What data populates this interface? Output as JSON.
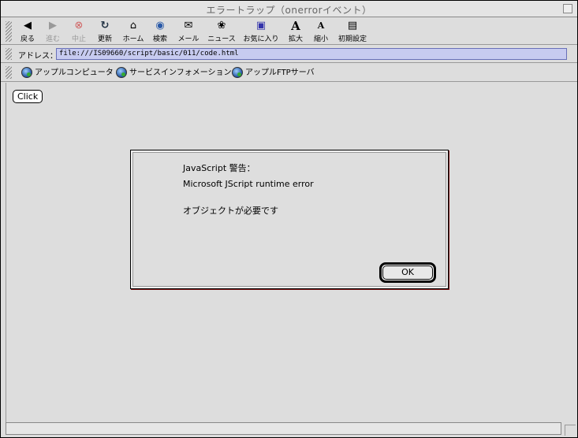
{
  "window": {
    "title": "エラートラップ（onerrorイベント）"
  },
  "toolbar": {
    "buttons": [
      {
        "label": "戻る",
        "icon": "back-arrow-icon",
        "glyph": "◆",
        "enabled": true
      },
      {
        "label": "進む",
        "icon": "forward-arrow-icon",
        "glyph": "➡",
        "enabled": false
      },
      {
        "label": "中止",
        "icon": "stop-icon",
        "glyph": "⊗",
        "enabled": false
      },
      {
        "label": "更新",
        "icon": "refresh-icon",
        "glyph": "C",
        "enabled": true
      },
      {
        "label": "ホーム",
        "icon": "home-icon",
        "glyph": "⌂",
        "enabled": true
      },
      {
        "label": "検索",
        "icon": "search-globe-icon",
        "glyph": "◉",
        "enabled": true
      },
      {
        "label": "メール",
        "icon": "mail-icon",
        "glyph": "✉",
        "enabled": true
      },
      {
        "label": "ニュース",
        "icon": "news-icon",
        "glyph": "❀",
        "enabled": true
      },
      {
        "label": "お気に入り",
        "icon": "favorites-icon",
        "glyph": "✱",
        "enabled": true
      },
      {
        "label": "拡大",
        "icon": "larger-text-icon",
        "glyph": "A",
        "enabled": true
      },
      {
        "label": "縮小",
        "icon": "smaller-text-icon",
        "glyph": "A",
        "enabled": true
      },
      {
        "label": "初期設定",
        "icon": "preferences-icon",
        "glyph": "▤",
        "enabled": true
      }
    ]
  },
  "address": {
    "label": "アドレス：",
    "url": "file:///IS09660/script/basic/011/code.html"
  },
  "links": [
    {
      "label": "アップルコンピュータ"
    },
    {
      "label": "サービスインフォメーション"
    },
    {
      "label": "アップルFTPサーバ"
    }
  ],
  "page": {
    "click_button": "Click"
  },
  "dialog": {
    "title": "JavaScript 警告：",
    "message": "Microsoft JScript runtime error",
    "detail": "オブジェクトが必要です",
    "ok_label": "OK"
  },
  "colors": {
    "window_bg": "#dddddd",
    "address_field_bg": "#c7cbf0",
    "dialog_shadow": "#7a1010"
  }
}
